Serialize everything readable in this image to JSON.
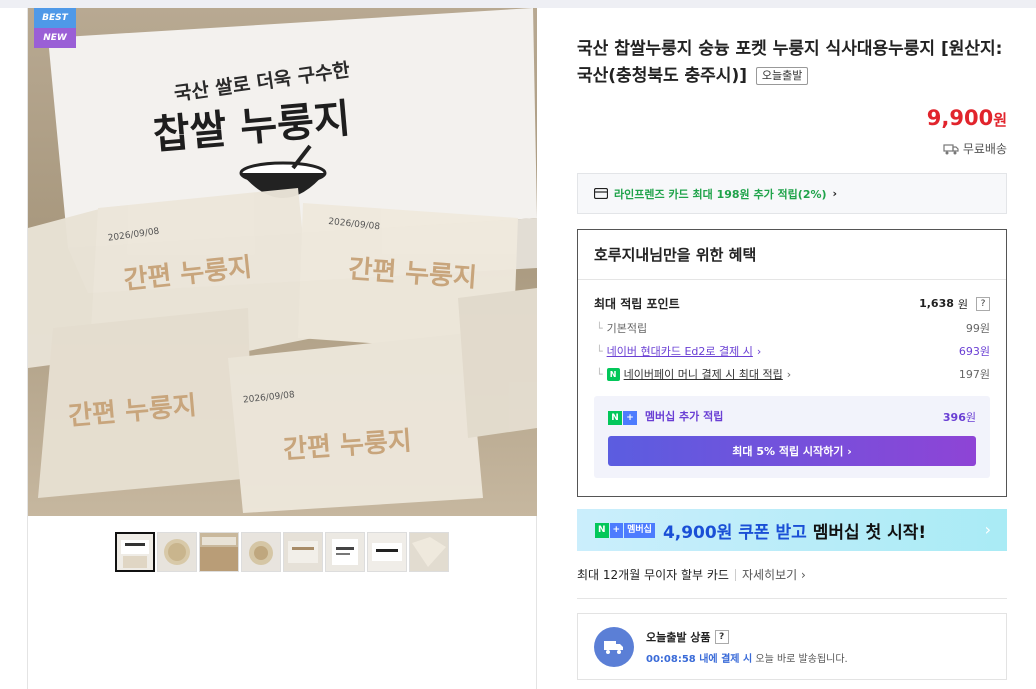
{
  "badges": {
    "best": "BEST",
    "new": "NEW"
  },
  "product": {
    "title": "국산 찹쌀누룽지 숭늉 포켓 누룽지 식사대용누룽지 [원산지:국산(충청북도 충주시)]",
    "title_tag": "오늘출발",
    "price": "9,900",
    "price_unit": "원",
    "shipping": "무료배송",
    "image_text": {
      "box_subtitle": "국산 쌀로 더욱 구수한",
      "box_title": "찹쌀 누룽지",
      "pack_label": "간편 누룽지",
      "pack_date": "2026/09/08"
    }
  },
  "thumbnails": [
    "thumb-1",
    "thumb-2",
    "thumb-3",
    "thumb-4",
    "thumb-5",
    "thumb-6",
    "thumb-7",
    "thumb-8"
  ],
  "card_promo": {
    "text": "라인프렌즈 카드 최대 198원 추가 적립(2%)",
    "chevron": "›"
  },
  "benefits": {
    "title": "호루지내님만을 위한 혜택",
    "max_points_label": "최대 적립 포인트",
    "max_points_value": "1,638",
    "max_points_unit": "원",
    "help": "?",
    "basic_label": "기본적립",
    "basic_value": "99원",
    "card_label": "네이버 현대카드 Ed2로 결제 시",
    "card_value": "693원",
    "npay_label": "네이버페이 머니 결제 시 최대 적립",
    "npay_value": "197원",
    "membership_label": "멤버십 추가 적립",
    "membership_value": "396",
    "membership_unit": "원",
    "membership_button": "최대 5% 적립 시작하기 ›"
  },
  "banner": {
    "tag_n": "N",
    "tag_plus": "+",
    "tag_label": "멤버십",
    "amount": "4,900원 쿠폰 받고",
    "text": "멤버십 첫 시작!",
    "chevron": "›"
  },
  "installment": {
    "text": "최대 12개월 무이자 할부 카드",
    "more": "자세히보기 ›"
  },
  "today_shipping": {
    "title": "오늘출발 상품",
    "help": "?",
    "time": "00:08:58 내에 결제 시",
    "suffix": " 오늘 바로 발송됩니다."
  }
}
